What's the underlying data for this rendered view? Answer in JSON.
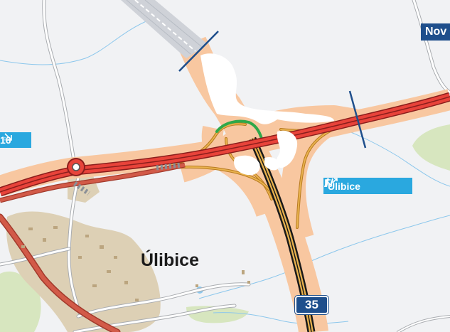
{
  "map": {
    "colors": {
      "background": "#f1f2f4",
      "built_up": "#ddd0b5",
      "forest": "#d7e6bf",
      "water": "#8cc7ec",
      "motorway_casing": "#f8c7a0",
      "motorway": "#e8433a",
      "motorway_under_construction": "#cfd2d8",
      "ramp": "#d99b38",
      "highlight_ramp": "#2fa84a",
      "tunnel": "#9aa0a8",
      "border_tick": "#1f4f8c",
      "exit_label": "#2aa8df",
      "road_shield": "#1f4f8c"
    },
    "labels": {
      "town": "Úlibice",
      "exit_label_text": "Úlibice",
      "exit_left_partial": "16",
      "top_right_partial": "Nov",
      "road_number": "35"
    },
    "icons": [
      "arrow-up-left-icon",
      "motorway-exit-icon",
      "arrow-down-right-icon",
      "roundabout-icon"
    ]
  }
}
